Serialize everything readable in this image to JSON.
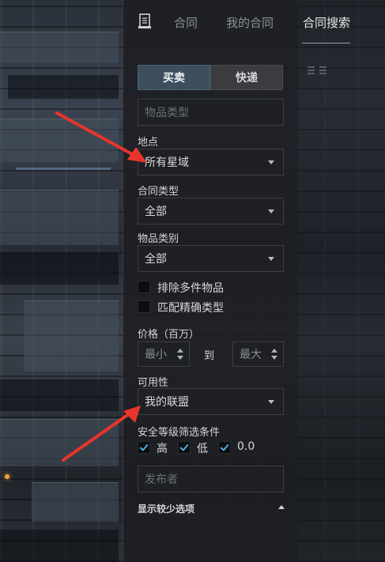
{
  "tabs": [
    {
      "label": "合同",
      "active": false
    },
    {
      "label": "我的合同",
      "active": false
    },
    {
      "label": "合同搜索",
      "active": true
    }
  ],
  "segment": {
    "buy_label": "买卖",
    "courier_label": "快递",
    "selected": "买卖"
  },
  "item_type": {
    "placeholder": "物品类型"
  },
  "location": {
    "label": "地点",
    "value": "所有星域"
  },
  "contract_type": {
    "label": "合同类型",
    "value": "全部"
  },
  "item_category": {
    "label": "物品类别",
    "value": "全部"
  },
  "exclude_multiple": {
    "label": "排除多件物品",
    "checked": false
  },
  "exact_match": {
    "label": "匹配精确类型",
    "checked": false
  },
  "price": {
    "label": "价格（百万）",
    "min_placeholder": "最小",
    "to_label": "到",
    "max_placeholder": "最大"
  },
  "availability": {
    "label": "可用性",
    "value": "我的联盟"
  },
  "security": {
    "label": "安全等级筛选条件",
    "options": [
      {
        "label": "高",
        "checked": true
      },
      {
        "label": "低",
        "checked": true
      },
      {
        "label": "0.0",
        "checked": true
      }
    ]
  },
  "issuer": {
    "placeholder": "发布者"
  },
  "show_less_label": "显示较少选项",
  "colors": {
    "accent_check": "#4fb0e4",
    "annotation_arrow": "#e8352b",
    "active_segment": "#3d4f5c"
  }
}
